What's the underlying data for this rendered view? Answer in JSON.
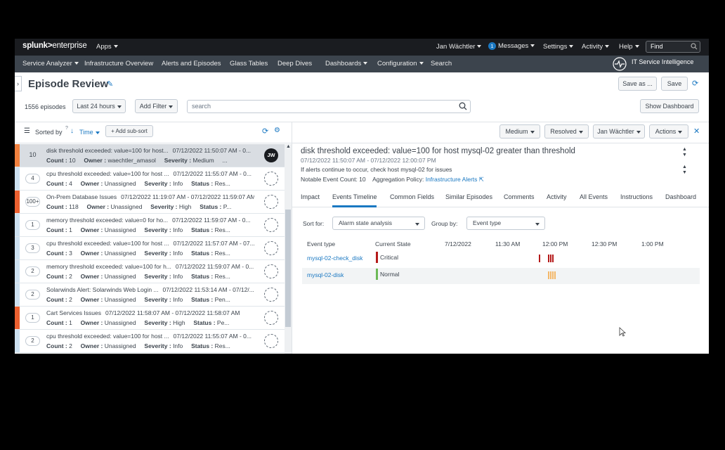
{
  "topbar": {
    "logo_main": "splunk",
    "logo_sep": ">",
    "logo_sub": "enterprise",
    "apps": "Apps",
    "user": "Jan Wächtler",
    "messages_count": "1",
    "messages": "Messages",
    "settings": "Settings",
    "activity": "Activity",
    "help": "Help",
    "find_placeholder": "Find"
  },
  "appbar": {
    "items": [
      "Service Analyzer",
      "Infrastructure Overview",
      "Alerts and Episodes",
      "Glass Tables",
      "Deep Dives",
      "Dashboards",
      "Configuration",
      "Search"
    ],
    "app_name": "IT Service Intelligence"
  },
  "page": {
    "title": "Episode Review",
    "save_as": "Save as ...",
    "save": "Save",
    "episode_count": "1556 episodes",
    "time_range": "Last 24 hours",
    "add_filter": "Add Filter",
    "search_placeholder": "search",
    "show_dashboard": "Show Dashboard"
  },
  "list_header": {
    "sorted_by": "Sorted by",
    "help_mark": "?",
    "sort_field": "Time",
    "add_subsort": "+ Add sub-sort"
  },
  "episodes": [
    {
      "count": "10",
      "title": "disk threshold exceeded: value=100 for host...",
      "time": "07/12/2022 11:50:07 AM - 0...",
      "count_label": "Count :",
      "count_val": "10",
      "owner_label": "Owner :",
      "owner": "waechtler_amasol",
      "severity_label": "Severity :",
      "severity": "Medium",
      "status": "...",
      "avatar": "JW",
      "color": "#f1813f"
    },
    {
      "count": "4",
      "title": "cpu threshold exceeded: value=100 for host ...",
      "time": "07/12/2022 11:55:07 AM - 0...",
      "count_label": "Count :",
      "count_val": "4",
      "owner_label": "Owner :",
      "owner": "Unassigned",
      "severity_label": "Severity :",
      "severity": "Info",
      "status_label": "Status :",
      "status": "Res...",
      "color": "#cde1f1"
    },
    {
      "count": "100+",
      "title": "On-Prem Database Issues",
      "time": "07/12/2022 11:19:07 AM - 07/12/2022 11:59:07 AM",
      "count_label": "Count :",
      "count_val": "118",
      "owner_label": "Owner :",
      "owner": "Unassigned",
      "severity_label": "Severity :",
      "severity": "High",
      "status_label": "Status :",
      "status": "P...",
      "color": "#ec6030"
    },
    {
      "count": "1",
      "title": "memory threshold exceeded: value=0 for ho...",
      "time": "07/12/2022 11:59:07 AM - 0...",
      "count_label": "Count :",
      "count_val": "1",
      "owner_label": "Owner :",
      "owner": "Unassigned",
      "severity_label": "Severity :",
      "severity": "Info",
      "status_label": "Status :",
      "status": "Res...",
      "color": "#cde1f1"
    },
    {
      "count": "3",
      "title": "cpu threshold exceeded: value=100 for host ...",
      "time": "07/12/2022 11:57:07 AM - 07...",
      "count_label": "Count :",
      "count_val": "3",
      "owner_label": "Owner :",
      "owner": "Unassigned",
      "severity_label": "Severity :",
      "severity": "Info",
      "status_label": "Status :",
      "status": "Res...",
      "color": "#cde1f1"
    },
    {
      "count": "2",
      "title": "memory threshold exceeded: value=100 for h...",
      "time": "07/12/2022 11:59:07 AM - 0...",
      "count_label": "Count :",
      "count_val": "2",
      "owner_label": "Owner :",
      "owner": "Unassigned",
      "severity_label": "Severity :",
      "severity": "Info",
      "status_label": "Status :",
      "status": "Res...",
      "color": "#cde1f1"
    },
    {
      "count": "2",
      "title": "Solarwinds Alert: Solarwinds Web Login ...",
      "time": "07/12/2022 11:53:14 AM - 07/12/...",
      "count_label": "Count :",
      "count_val": "2",
      "owner_label": "Owner :",
      "owner": "Unassigned",
      "severity_label": "Severity :",
      "severity": "Info",
      "status_label": "Status :",
      "status": "Pen...",
      "color": "#cde1f1"
    },
    {
      "count": "1",
      "title": "Cart Services Issues",
      "time": "07/12/2022 11:58:07 AM - 07/12/2022 11:58:07 AM",
      "count_label": "Count :",
      "count_val": "1",
      "owner_label": "Owner :",
      "owner": "Unassigned",
      "severity_label": "Severity :",
      "severity": "High",
      "status_label": "Status :",
      "status": "Pe...",
      "color": "#ec6030"
    },
    {
      "count": "2",
      "title": "cpu threshold exceeded: value=100 for host ...",
      "time": "07/12/2022 11:55:07 AM - 0...",
      "count_label": "Count :",
      "count_val": "2",
      "owner_label": "Owner :",
      "owner": "Unassigned",
      "severity_label": "Severity :",
      "severity": "Info",
      "status_label": "Status :",
      "status": "Res...",
      "color": "#cde1f1"
    }
  ],
  "detail": {
    "severity": "Medium",
    "status": "Resolved",
    "owner": "Jan Wächtler",
    "actions": "Actions",
    "title": "disk threshold exceeded: value=100 for host mysql-02 greater than threshold",
    "time": "07/12/2022 11:50:07 AM - 07/12/2022 12:00:07 PM",
    "description": "If alerts continue to occur, check host mysql-02 for issues",
    "notable_label": "Notable Event Count: 10",
    "policy_label": "Aggregation Policy:",
    "policy_link": "Infrastructure Alerts",
    "tabs": [
      "Impact",
      "Events Timeline",
      "Common Fields",
      "Similar Episodes",
      "Comments",
      "Activity",
      "All Events",
      "Instructions",
      "Dashboard"
    ],
    "sort_for_label": "Sort for:",
    "sort_for_value": "Alarm state analysis",
    "group_by_label": "Group by:",
    "group_by_value": "Event type"
  },
  "timeline": {
    "col_event_type": "Event type",
    "col_state": "Current State",
    "ticks": [
      "7/12/2022",
      "11:30 AM",
      "12:00 PM",
      "12:30 PM",
      "1:00 PM"
    ],
    "rows": [
      {
        "name": "mysql-02-check_disk",
        "state": "Critical",
        "state_color": "#b51a1a"
      },
      {
        "name": "mysql-02-disk",
        "state": "Normal",
        "state_color": "#6cb956"
      }
    ]
  }
}
